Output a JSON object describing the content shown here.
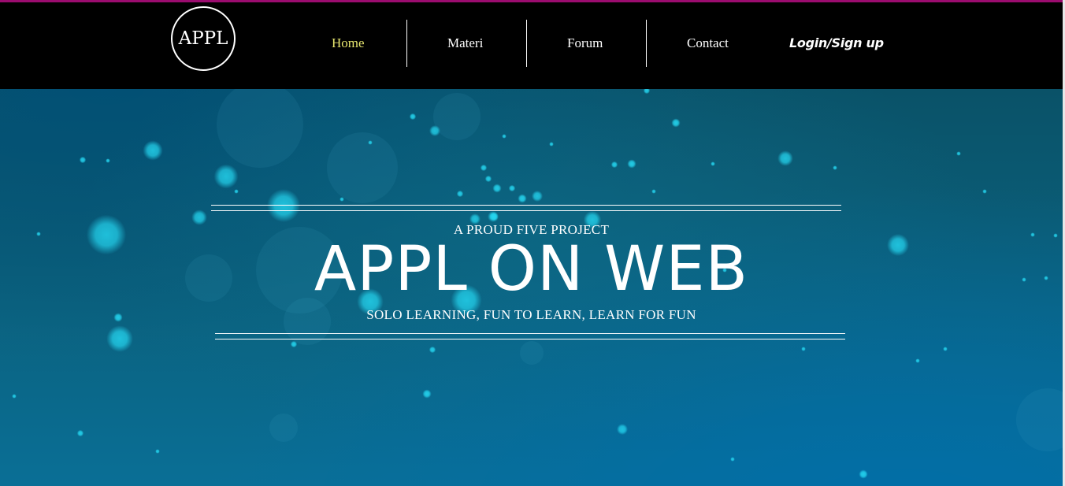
{
  "header": {
    "logo_text": "APPL",
    "nav": {
      "home": "Home",
      "materi": "Materi",
      "forum": "Forum",
      "contact": "Contact",
      "login": "Login/Sign up"
    },
    "active_item": "home"
  },
  "hero": {
    "tagline": "A PROUD FIVE PROJECT",
    "title": "APPL ON WEB",
    "subtitle": "SOLO LEARNING, FUN TO LEARN, LEARN FOR FUN"
  },
  "colors": {
    "top_accent": "#9b0c6f",
    "nav_background": "#000000",
    "nav_text": "#ffffff",
    "nav_active": "#e7e66f",
    "hero_background": "#0b5f7a",
    "particle": "#25d8f2"
  }
}
